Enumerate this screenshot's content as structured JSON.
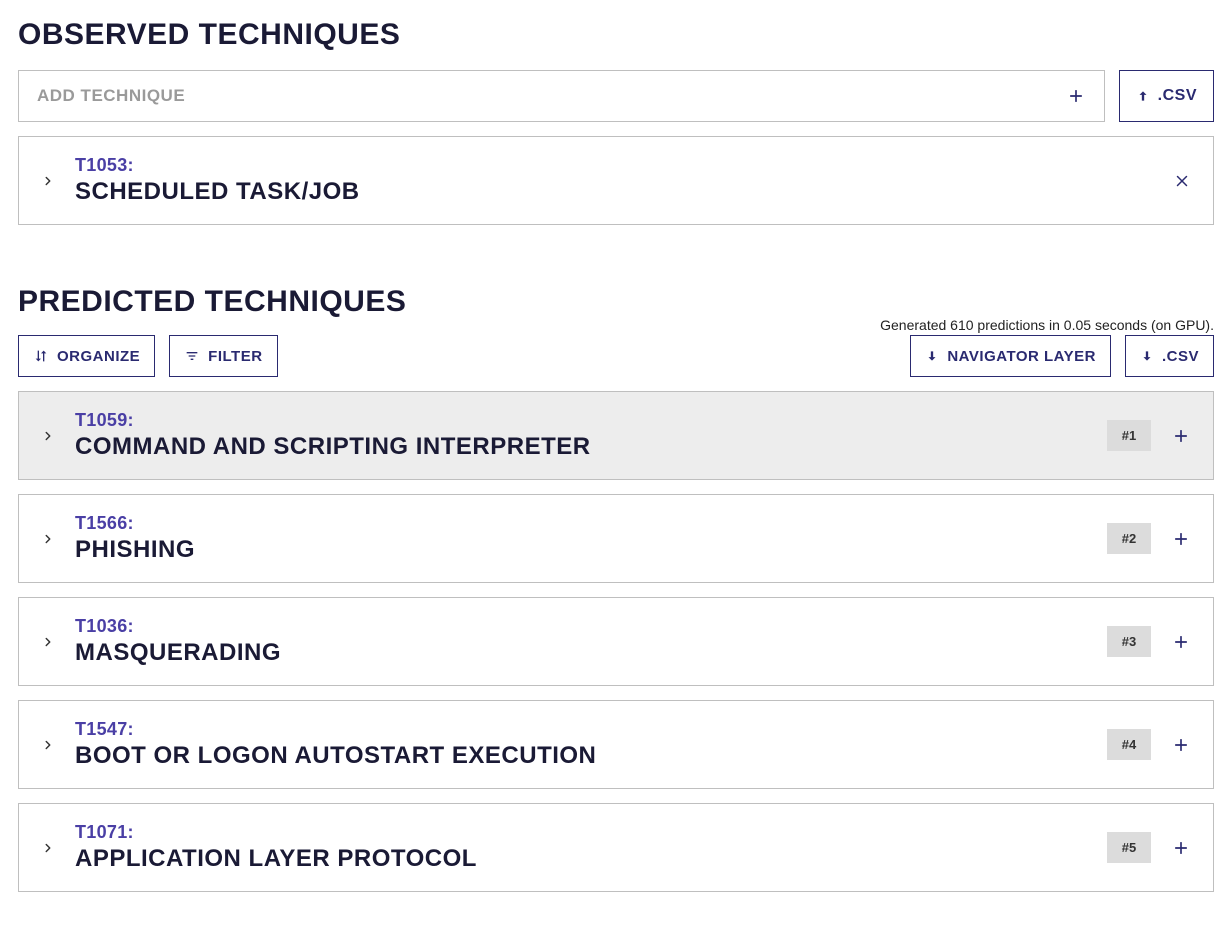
{
  "observed": {
    "heading": "OBSERVED TECHNIQUES",
    "add_placeholder": "ADD TECHNIQUE",
    "csv_label": ".CSV",
    "items": [
      {
        "id": "T1053:",
        "name": "SCHEDULED TASK/JOB"
      }
    ]
  },
  "predicted": {
    "heading": "PREDICTED TECHNIQUES",
    "generated_text": "Generated 610 predictions in 0.05 seconds (on GPU).",
    "organize_label": "ORGANIZE",
    "filter_label": "FILTER",
    "navigator_label": "NAVIGATOR LAYER",
    "csv_label": ".CSV",
    "items": [
      {
        "id": "T1059:",
        "name": "COMMAND AND SCRIPTING INTERPRETER",
        "rank": "#1",
        "highlight": true
      },
      {
        "id": "T1566:",
        "name": "PHISHING",
        "rank": "#2",
        "highlight": false
      },
      {
        "id": "T1036:",
        "name": "MASQUERADING",
        "rank": "#3",
        "highlight": false
      },
      {
        "id": "T1547:",
        "name": "BOOT OR LOGON AUTOSTART EXECUTION",
        "rank": "#4",
        "highlight": false
      },
      {
        "id": "T1071:",
        "name": "APPLICATION LAYER PROTOCOL",
        "rank": "#5",
        "highlight": false
      }
    ]
  }
}
